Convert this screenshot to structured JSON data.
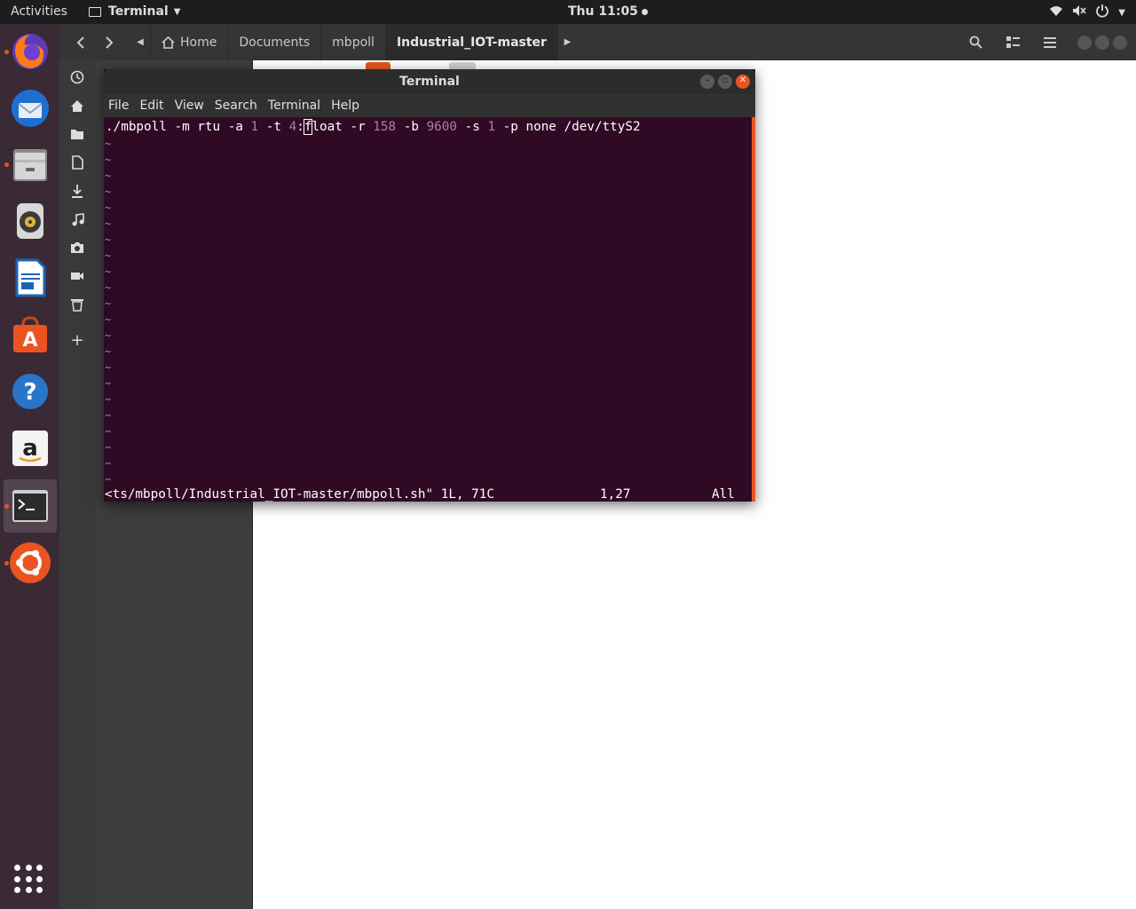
{
  "topbar": {
    "activities": "Activities",
    "app_menu": "Terminal",
    "clock": "Thu 11:05"
  },
  "dock": {
    "items": [
      {
        "name": "firefox",
        "icon": "firefox-icon",
        "running": true
      },
      {
        "name": "thunderbird",
        "icon": "thunderbird-icon",
        "running": false
      },
      {
        "name": "files",
        "icon": "files-icon",
        "running": true
      },
      {
        "name": "rhythmbox",
        "icon": "rhythmbox-icon",
        "running": false
      },
      {
        "name": "libreoffice-writer",
        "icon": "writer-icon",
        "running": false
      },
      {
        "name": "ubuntu-software",
        "icon": "software-icon",
        "running": false
      },
      {
        "name": "help",
        "icon": "help-icon",
        "running": false
      },
      {
        "name": "amazon",
        "icon": "amazon-icon",
        "running": false
      },
      {
        "name": "terminal",
        "icon": "terminal-icon",
        "running": true
      },
      {
        "name": "ubuntu",
        "icon": "ubuntu-icon",
        "running": true
      }
    ]
  },
  "files": {
    "breadcrumbs": [
      "Home",
      "Documents",
      "mbpoll",
      "Industrial_IOT-master"
    ],
    "sidebar_icons": [
      "recent-icon",
      "home-icon",
      "folder-icon",
      "document-icon",
      "download-icon",
      "music-icon",
      "camera-icon",
      "video-icon",
      "trash-icon",
      "plus-icon"
    ]
  },
  "terminal": {
    "title": "Terminal",
    "menu": [
      "File",
      "Edit",
      "View",
      "Search",
      "Terminal",
      "Help"
    ],
    "line": {
      "p1": "./mbpoll -m rtu -a ",
      "n1": "1",
      "p2": " -t ",
      "n2": "4",
      "p3": ":",
      "cursor": "f",
      "p4": "loat -r ",
      "n3": "158",
      "p5": " -b ",
      "n4": "9600",
      "p6": " -s ",
      "n5": "1",
      "p7": " -p none /dev/ttyS2"
    },
    "tilde": "~",
    "status": {
      "file": "<ts/mbpoll/Industrial_IOT-master/mbpoll.sh\" 1L, 71C",
      "position": "1,27",
      "scroll": "All"
    }
  },
  "colors": {
    "terminal_bg": "#300a24",
    "accent": "#e95420",
    "number": "#ad7fa8",
    "tilde": "#7f8fd8"
  }
}
